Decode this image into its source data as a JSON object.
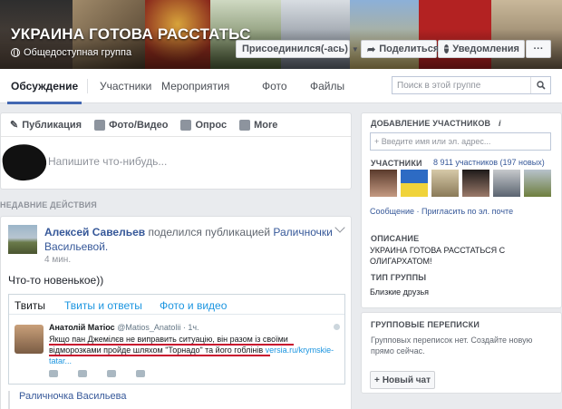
{
  "group": {
    "title": "УКРАИНА ГОТОВА РАССТАТЬС",
    "privacy": "Общедоступная группа"
  },
  "cover_buttons": {
    "join": "Присоединился(-ась)",
    "share": "Поделиться",
    "notifications": "Уведомления",
    "more": "···"
  },
  "tabs": [
    "Обсуждение",
    "Участники",
    "Мероприятия",
    "Фото",
    "Файлы"
  ],
  "search": {
    "placeholder": "Поиск в этой группе"
  },
  "composer": {
    "actions": [
      "Публикация",
      "Фото/Видео",
      "Опрос",
      "More"
    ],
    "placeholder": "Напишите что-нибудь..."
  },
  "recent_label": "НЕДАВНИЕ ДЕЙСТВИЯ",
  "post": {
    "author": "Алексей Савельев",
    "action": "поделился публикацией",
    "target": "Раличночки Васильевой.",
    "time": "4 мин.",
    "text": "Что-то новенькое))",
    "embed": {
      "tabs": [
        "Твиты",
        "Твиты и ответы",
        "Фото и видео"
      ],
      "name": "Анатолій Матіос",
      "handle": "@Matios_Anatolii · 1ч.",
      "body": "Якщо пан Джемілєв не виправить ситуацію, він разом із своїми відморозками пройде шляхом \"Торнадо\" та його гоблінів",
      "link": "versia.ru/krymskie-tatar..."
    },
    "reply_name": "Раличночка Васильева"
  },
  "sidebar": {
    "add_members_heading": "ДОБАВЛЕНИЕ УЧАСТНИКОВ",
    "add_members_placeholder": "+ Введите имя или эл. адрес...",
    "members_heading": "УЧАСТНИКИ",
    "members_count": "8 911 участников (197 новых)",
    "links": "Сообщение · Пригласить по эл. почте",
    "description_heading": "ОПИСАНИЕ",
    "description": "УКРАИНА ГОТОВА РАССТАТЬСЯ С ОЛИГАРХАТОМ!",
    "type_heading": "ТИП ГРУППЫ",
    "type_value": "Близкие друзья",
    "chats_heading": "ГРУППОВЫЕ ПЕРЕПИСКИ",
    "chats_text": "Групповых переписок нет. Создайте новую прямо сейчас.",
    "new_chat": "Новый чат"
  },
  "colors": {
    "accent": "#4267b2",
    "link": "#365899",
    "twitter_blue": "#1b95e0",
    "underline": "#c8102e"
  }
}
